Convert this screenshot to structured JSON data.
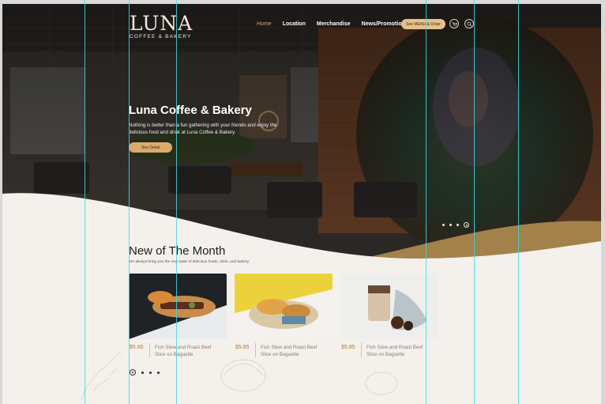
{
  "brand": {
    "name": "LUNA",
    "tagline": "COFFEE & BAKERY"
  },
  "nav": {
    "items": [
      "Home",
      "Location",
      "Merchandise",
      "News/Promotion"
    ],
    "active": "Home",
    "cta_label": "See MENU & Order",
    "icons": [
      "cart-icon",
      "search-icon"
    ]
  },
  "hero": {
    "title": "Luna Coffee & Bakery",
    "description": "Nothing is better than a fun gathering with your friends and enjoy the delicious food and drink at Luna Coffee & Bakery.",
    "button_label": "See Detail",
    "slides": 4,
    "active_slide": 4
  },
  "section": {
    "title": "New of The Month",
    "subtitle": "We always bring you the new taste of delicious foods, drink, and bakery.",
    "slides": 4,
    "active_slide": 1
  },
  "products": [
    {
      "price": "$5.85",
      "name": "Fish Stew and Roast Beef Slice on Baguette"
    },
    {
      "price": "$5.85",
      "name": "Fish Stew and Roast Beef Slice on Baguette"
    },
    {
      "price": "$5.85",
      "name": "Fish Stew and Roast Beef Slice on Baguette"
    }
  ],
  "colors": {
    "accent": "#d9aa6e",
    "price": "#b07a3a",
    "guide": "#3fd9e0",
    "hero_bg": "#2b2622"
  }
}
